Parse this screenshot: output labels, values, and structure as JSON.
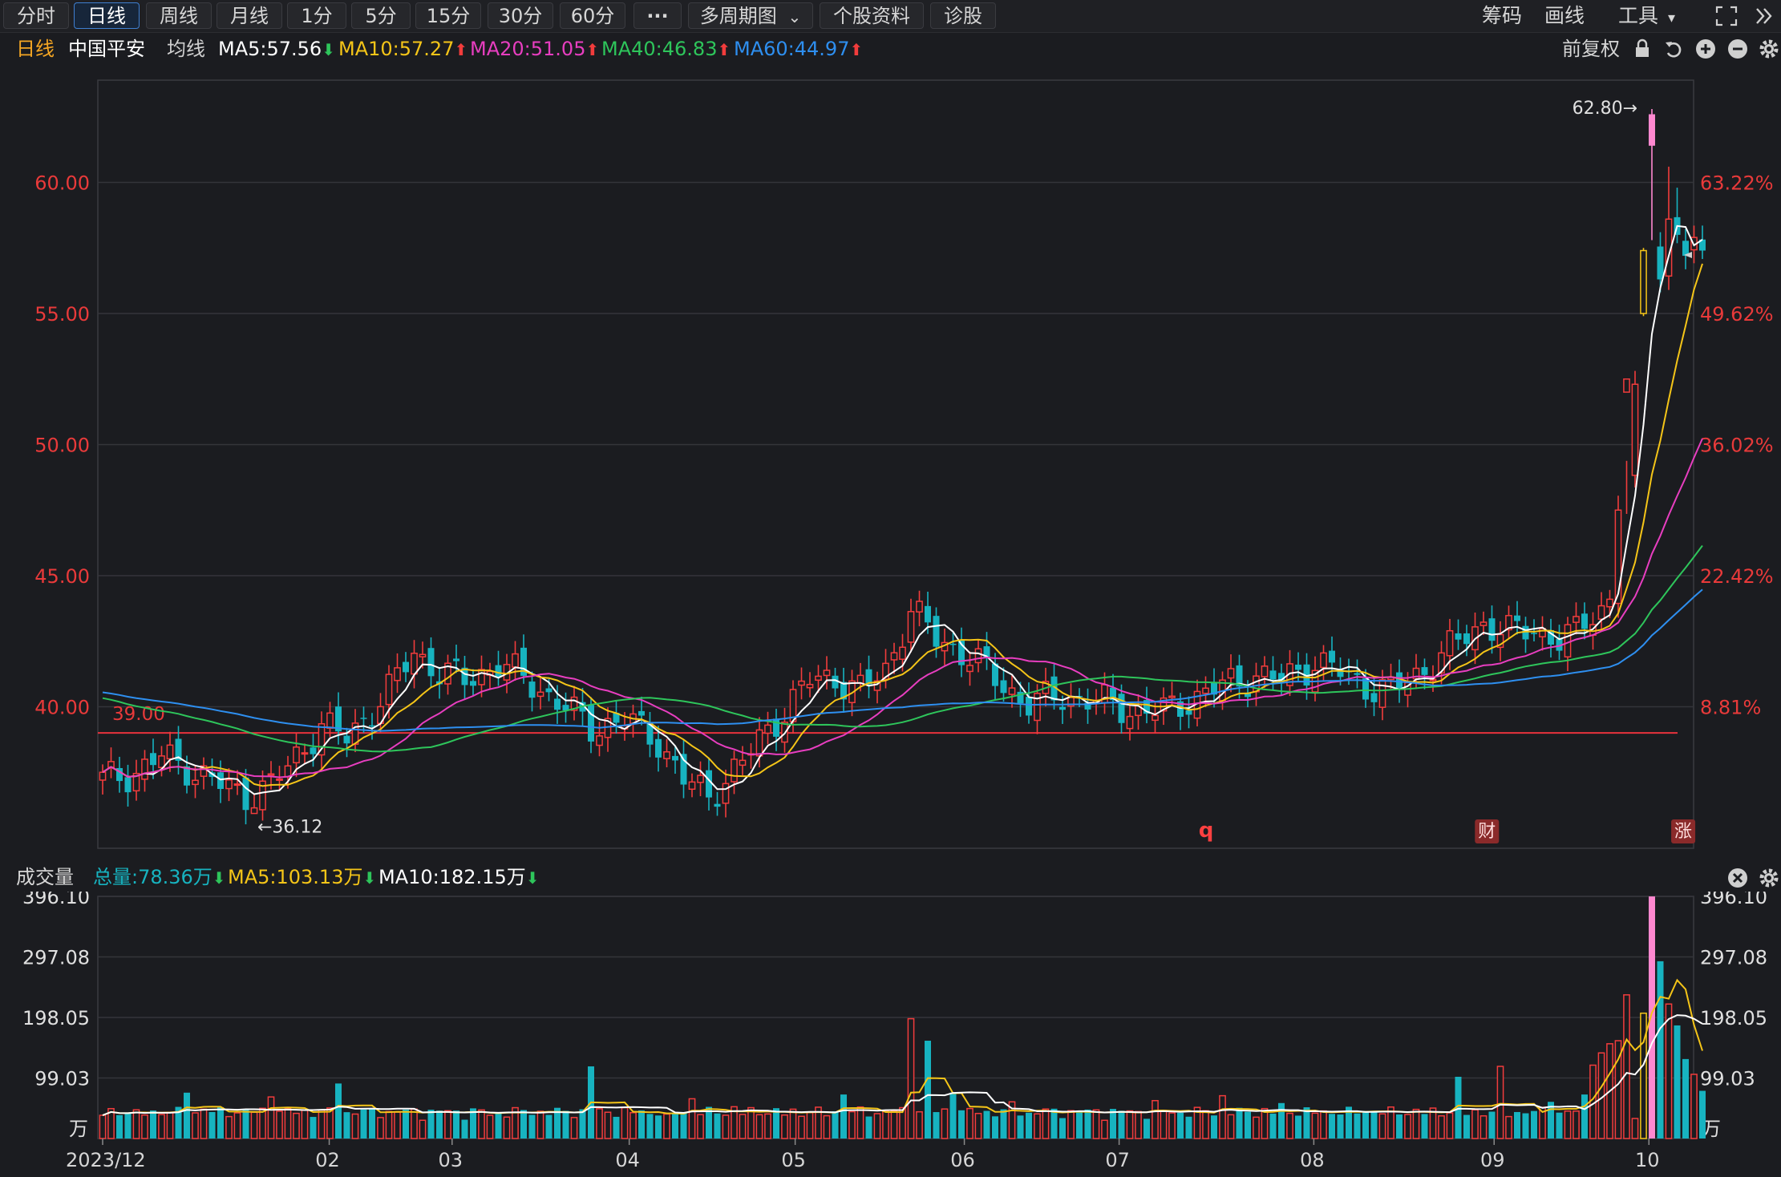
{
  "toolbar": {
    "tabs": [
      "分时",
      "日线",
      "周线",
      "月线",
      "1分",
      "5分",
      "15分",
      "30分",
      "60分",
      "···",
      "多周期图",
      "个股资料",
      "诊股"
    ],
    "active_tab": "日线",
    "multi_period_chevron": "⌄",
    "right_items": [
      "筹码",
      "画线",
      "工具"
    ],
    "tools_caret": "▾"
  },
  "info": {
    "period": "日线",
    "stock_name": "中国平安",
    "ma_label": "均线",
    "ma5": "MA5:57.56",
    "ma10": "MA10:57.27",
    "ma20": "MA20:51.05",
    "ma40": "MA40:46.83",
    "ma60": "MA60:44.97",
    "down_arrow": "⬇",
    "up_arrow": "⬆",
    "adjust": "前复权"
  },
  "volume_info": {
    "title": "成交量",
    "total": "总量:78.36万",
    "ma5": "MA5:103.13万",
    "ma10": "MA10:182.15万"
  },
  "colors": {
    "up": "#f23c3c",
    "down": "#17b3c0",
    "ma5": "#ffffff",
    "ma10": "#f5c518",
    "ma20": "#e83ec0",
    "ma40": "#2ec55b",
    "ma60": "#2e8ff0",
    "axis_text": "#e93a3a",
    "refline": "#e8323c"
  },
  "chart_data": {
    "type": "candlestick",
    "price_axis": {
      "ticks": [
        {
          "v": 60,
          "label": "60.00"
        },
        {
          "v": 55,
          "label": "55.00"
        },
        {
          "v": 50,
          "label": "50.00"
        },
        {
          "v": 45,
          "label": "45.00"
        },
        {
          "v": 40,
          "label": "40.00"
        }
      ],
      "pct_ticks": [
        {
          "v": 60,
          "label": "63.22%"
        },
        {
          "v": 55,
          "label": "49.62%"
        },
        {
          "v": 50,
          "label": "36.02%"
        },
        {
          "v": 45,
          "label": "22.42%"
        },
        {
          "v": 40,
          "label": "8.81%"
        }
      ],
      "range": [
        34.6,
        63.9
      ]
    },
    "reference_line": {
      "value": 39.0,
      "label": "39.00"
    },
    "annotations": {
      "high": "62.80→",
      "low": "←36.12"
    },
    "event_markers": [
      {
        "label": "q",
        "date_index": 7.0
      },
      {
        "label": "财",
        "date_index": 8.7
      },
      {
        "label": "涨",
        "date_index": 9.93
      }
    ],
    "x_ticks": [
      "2023/12",
      "02",
      "03",
      "04",
      "05",
      "06",
      "07",
      "08",
      "09",
      "10"
    ],
    "month_positions": [
      0,
      1.45,
      2.22,
      3.33,
      4.37,
      5.43,
      6.4,
      7.62,
      8.75,
      9.72
    ],
    "volume_axis": {
      "ticks": [
        {
          "v": 396.1,
          "label": "396.10"
        },
        {
          "v": 297.08,
          "label": "297.08"
        },
        {
          "v": 198.05,
          "label": "198.05"
        },
        {
          "v": 99.03,
          "label": "99.03"
        }
      ],
      "unit": "万"
    },
    "anchors": [
      [
        0,
        37.2
      ],
      [
        4,
        37.5
      ],
      [
        7,
        38.1
      ],
      [
        10,
        37.7
      ],
      [
        14,
        37.0
      ],
      [
        17,
        36.6
      ],
      [
        20,
        37.0
      ],
      [
        22,
        37.7
      ],
      [
        26,
        39.3
      ],
      [
        29,
        38.8
      ],
      [
        34,
        40.6
      ],
      [
        37,
        42.1
      ],
      [
        40,
        41.3
      ],
      [
        43,
        41.0
      ],
      [
        47,
        41.6
      ],
      [
        50,
        41.1
      ],
      [
        54,
        40.2
      ],
      [
        58,
        39.2
      ],
      [
        62,
        39.5
      ],
      [
        66,
        38.7
      ],
      [
        69,
        37.2
      ],
      [
        72,
        36.6
      ],
      [
        76,
        37.9
      ],
      [
        80,
        39.5
      ],
      [
        84,
        41.0
      ],
      [
        87,
        41.1
      ],
      [
        90,
        40.6
      ],
      [
        93,
        41.4
      ],
      [
        96,
        43.7
      ],
      [
        99,
        42.6
      ],
      [
        103,
        41.9
      ],
      [
        107,
        40.8
      ],
      [
        110,
        40.1
      ],
      [
        114,
        40.4
      ],
      [
        118,
        40.2
      ],
      [
        122,
        39.9
      ],
      [
        126,
        39.8
      ],
      [
        130,
        40.4
      ],
      [
        134,
        40.9
      ],
      [
        137,
        41.2
      ],
      [
        140,
        41.0
      ],
      [
        144,
        41.7
      ],
      [
        147,
        41.3
      ],
      [
        150,
        40.8
      ],
      [
        153,
        40.6
      ],
      [
        156,
        41.2
      ],
      [
        160,
        42.2
      ],
      [
        164,
        43.2
      ],
      [
        167,
        42.8
      ],
      [
        170,
        43.0
      ],
      [
        173,
        42.5
      ],
      [
        175,
        42.8
      ],
      [
        177,
        43.6
      ],
      [
        179,
        44.1
      ],
      [
        180,
        47.5
      ],
      [
        181,
        49.0
      ],
      [
        182,
        52.3
      ],
      [
        183,
        56.0
      ],
      [
        184,
        60.5
      ],
      [
        185,
        55.8
      ],
      [
        186,
        59.3
      ],
      [
        187,
        57.2
      ],
      [
        188,
        58.4
      ],
      [
        189,
        57.4
      ],
      [
        190,
        57.3
      ]
    ],
    "volume_spikes": {
      "4": 47,
      "10": 75,
      "12": 48,
      "20": 68,
      "28": 90,
      "30": 40,
      "46": 38,
      "58": 118,
      "67": 40,
      "70": 65,
      "75": 52,
      "82": 48,
      "88": 72,
      "96": 196,
      "98": 160,
      "101": 75,
      "108": 60,
      "125": 62,
      "133": 70,
      "140": 58,
      "150": 45,
      "161": 101,
      "166": 118,
      "172": 60,
      "176": 72,
      "177": 120,
      "178": 140,
      "179": 155,
      "180": 160,
      "181": 235,
      "183": 205,
      "184": 396,
      "185": 290,
      "186": 220,
      "187": 185,
      "188": 130,
      "189": 105,
      "190": 78
    },
    "price_high": 62.8,
    "price_low": 36.12
  }
}
